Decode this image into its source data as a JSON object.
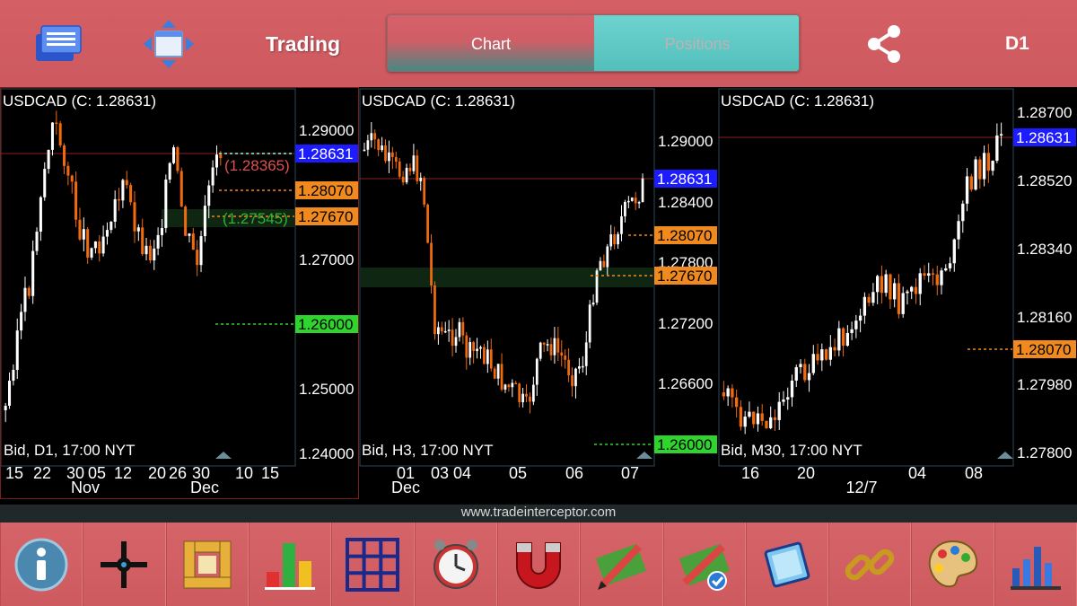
{
  "header": {
    "title": "Trading",
    "tabs": [
      {
        "label": "Chart",
        "active": true
      },
      {
        "label": "Positions",
        "active": false
      }
    ],
    "timeframe": "D1",
    "icons": [
      "menu-icon",
      "move-arrows-icon",
      "share-icon"
    ]
  },
  "chart_data": [
    {
      "type": "candlestick",
      "symbol_label": "USDCAD (C: 1.28631)",
      "info": "Bid, D1, 17:00 NYT",
      "ylim": [
        1.235,
        1.2955
      ],
      "y_ticks": [
        "1.29000",
        "1.27000",
        "1.25000",
        "1.24000"
      ],
      "x_ticks": [
        "15",
        "22",
        "30",
        "05",
        "12",
        "20",
        "26",
        "30",
        "10",
        "15"
      ],
      "x_month_labels": [
        "Nov",
        "Dec"
      ],
      "price_tags": [
        {
          "label": "1.28631",
          "color": "#1c1cff",
          "text_color": "#ffffff"
        },
        {
          "label": "1.28070",
          "color": "#f08a1e",
          "text_color": "#000000"
        },
        {
          "label": "1.27670",
          "color": "#f08a1e",
          "text_color": "#000000"
        },
        {
          "label": "1.26000",
          "color": "#2fd42f",
          "text_color": "#000000"
        }
      ],
      "annotations": [
        {
          "label": "(1.28365)",
          "color": "#e05050"
        },
        {
          "label": "(1.27545)",
          "color": "#2fb42f"
        }
      ]
    },
    {
      "type": "candlestick",
      "symbol_label": "USDCAD (C: 1.28631)",
      "info": "Bid, H3, 17:00 NYT",
      "ylim": [
        1.2395,
        1.2944
      ],
      "y_ticks": [
        "1.29000",
        "1.28400",
        "1.27800",
        "1.27200",
        "1.26600"
      ],
      "x_ticks": [
        "01",
        "03",
        "04",
        "05",
        "06",
        "07"
      ],
      "x_month_labels": [
        "Dec"
      ],
      "price_tags": [
        {
          "label": "1.28631",
          "color": "#1c1cff",
          "text_color": "#ffffff"
        },
        {
          "label": "1.28070",
          "color": "#f08a1e",
          "text_color": "#000000"
        },
        {
          "label": "1.27670",
          "color": "#f08a1e",
          "text_color": "#000000"
        },
        {
          "label": "1.26000",
          "color": "#2fd42f",
          "text_color": "#000000"
        }
      ]
    },
    {
      "type": "candlestick",
      "symbol_label": "USDCAD (C: 1.28631)",
      "info": "Bid, M30, 17:00 NYT",
      "ylim": [
        1.2776,
        1.2874
      ],
      "y_ticks": [
        "1.28700",
        "1.28520",
        "1.28340",
        "1.28160",
        "1.27980",
        "1.27800"
      ],
      "x_ticks": [
        "16",
        "20",
        "04",
        "08"
      ],
      "x_month_labels": [
        "12/7"
      ],
      "price_tags": [
        {
          "label": "1.28631",
          "color": "#1c1cff",
          "text_color": "#ffffff"
        },
        {
          "label": "1.28070",
          "color": "#f08a1e",
          "text_color": "#000000"
        }
      ]
    }
  ],
  "footer": {
    "url": "www.tradeinterceptor.com"
  },
  "toolbar": {
    "tools": [
      "info-icon",
      "crosshair-icon",
      "ruler-icon",
      "indicators-icon",
      "grid-layout-icon",
      "alarm-clock-icon",
      "magnet-icon",
      "drawing-tools-icon",
      "drawing-tools-settings-icon",
      "templates-icon",
      "link-icon",
      "palette-icon",
      "chart-analysis-icon"
    ]
  },
  "colors": {
    "accent": "#d45f65",
    "bull": "#ffffff",
    "bear": "#f06a0e",
    "panel_border": "#2e4a55"
  }
}
